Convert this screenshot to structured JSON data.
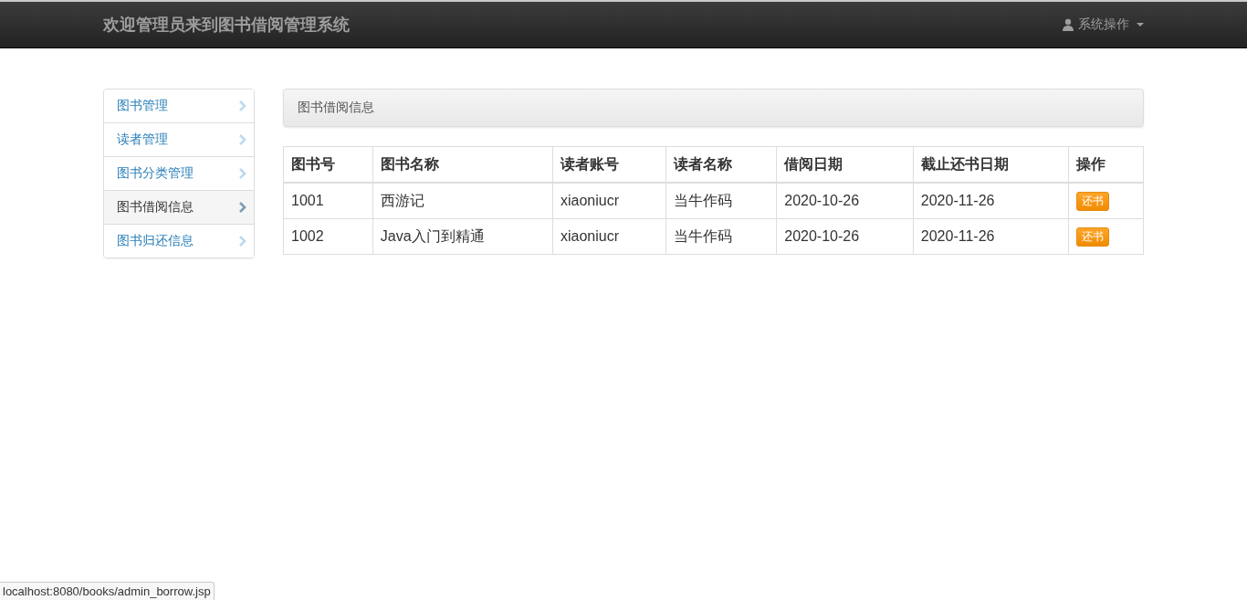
{
  "navbar": {
    "brand": "欢迎管理员来到图书借阅管理系统",
    "menu": "系统操作"
  },
  "sidebar": {
    "items": [
      {
        "label": "图书管理",
        "selected": false
      },
      {
        "label": "读者管理",
        "selected": false
      },
      {
        "label": "图书分类管理",
        "selected": false
      },
      {
        "label": "图书借阅信息",
        "selected": true
      },
      {
        "label": "图书归还信息",
        "selected": false
      }
    ]
  },
  "panel": {
    "title": "图书借阅信息"
  },
  "table": {
    "columns": [
      "图书号",
      "图书名称",
      "读者账号",
      "读者名称",
      "借阅日期",
      "截止还书日期",
      "操作"
    ],
    "rows": [
      {
        "cells": [
          "1001",
          "西游记",
          "xiaoniucr",
          "当牛作码",
          "2020-10-26",
          "2020-11-26"
        ],
        "action": "还书"
      },
      {
        "cells": [
          "1002",
          "Java入门到精通",
          "xiaoniucr",
          "当牛作码",
          "2020-10-26",
          "2020-11-26"
        ],
        "action": "还书"
      }
    ]
  },
  "status_bar": "localhost:8080/books/admin_borrow.jsp"
}
